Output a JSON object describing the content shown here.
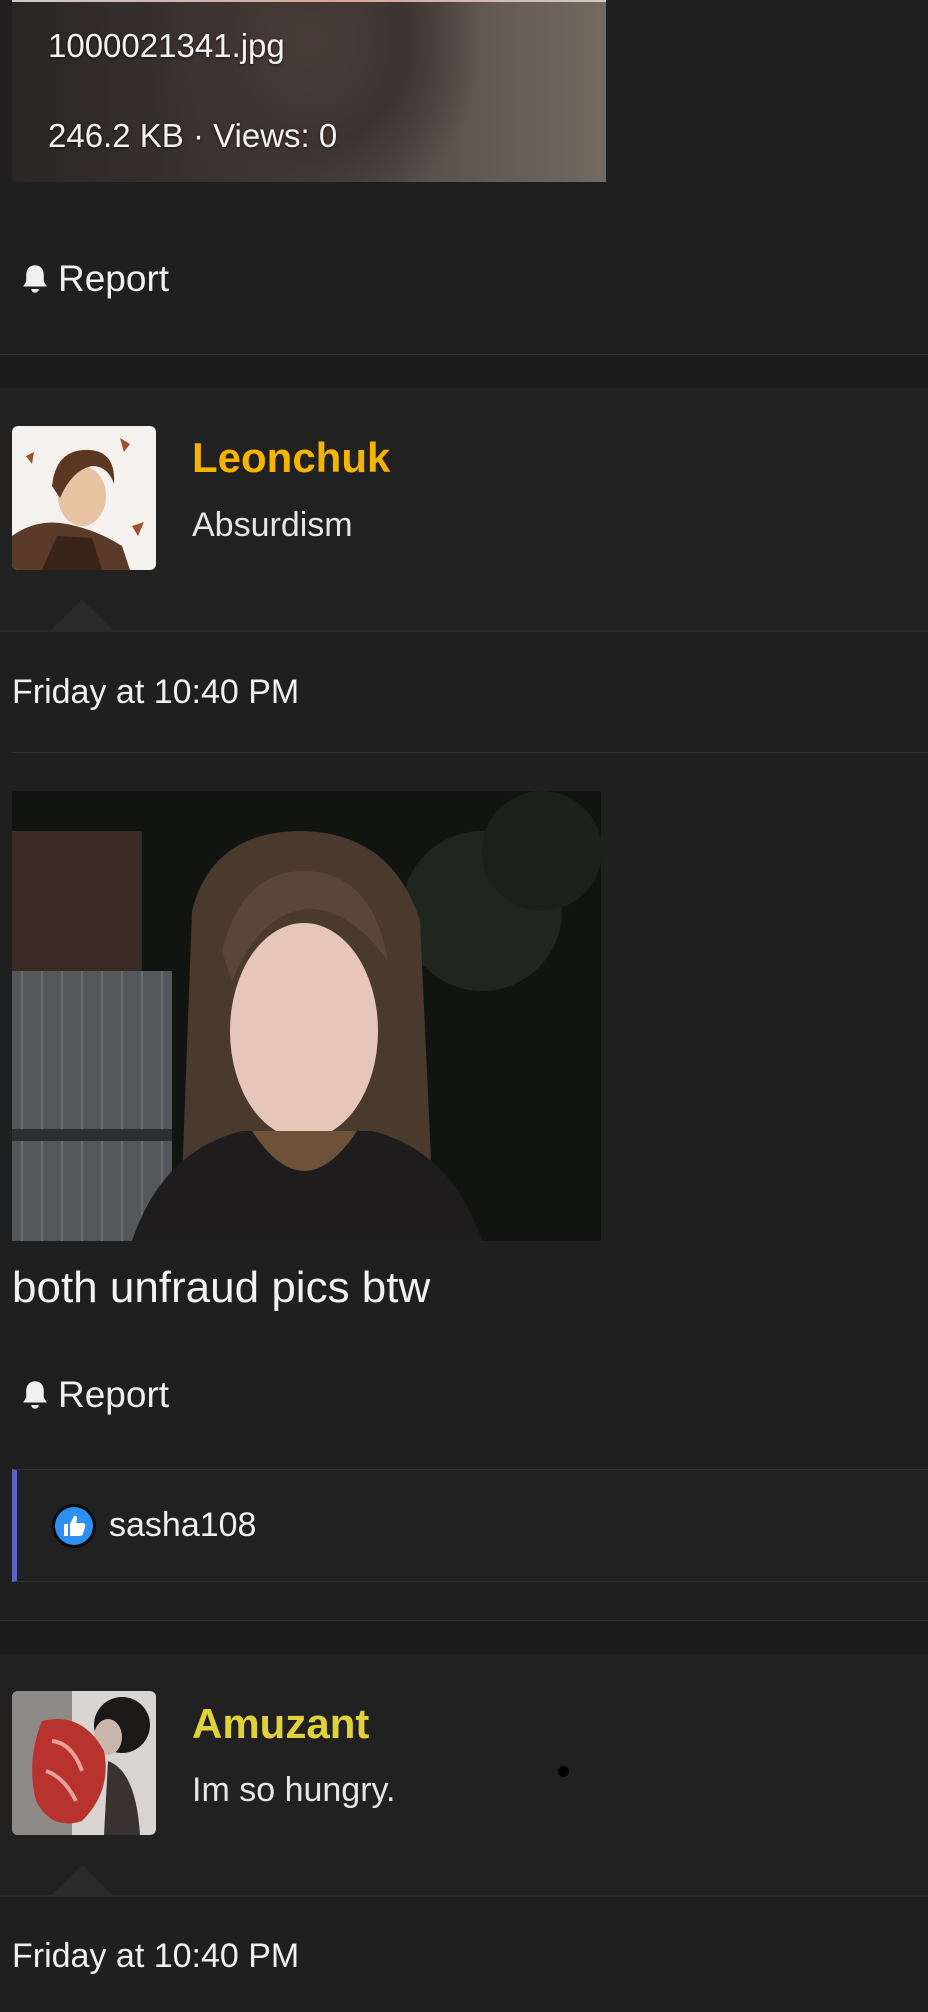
{
  "attachment": {
    "filename": "1000021341.jpg",
    "meta": "246.2 KB · Views: 0"
  },
  "posts": [
    {
      "report_label": "Report"
    },
    {
      "username": "Leonchuk",
      "username_color": "#f5b400",
      "user_title": "Absurdism",
      "timestamp": "Friday at 10:40 PM",
      "text": "both unfraud pics btw",
      "report_label": "Report",
      "reactions": {
        "user": "sasha108",
        "icon": "like-icon"
      }
    },
    {
      "username": "Amuzant",
      "username_color": "#e2d23a",
      "user_title": "Im so hungry.",
      "timestamp": "Friday at 10:40 PM"
    }
  ],
  "icons": {
    "report": "bell-icon",
    "reaction": "thumbs-up-icon"
  },
  "colors": {
    "background": "#1f1f1f",
    "reaction_accent": "#5b63c4",
    "like_blue": "#2d8ff0"
  }
}
